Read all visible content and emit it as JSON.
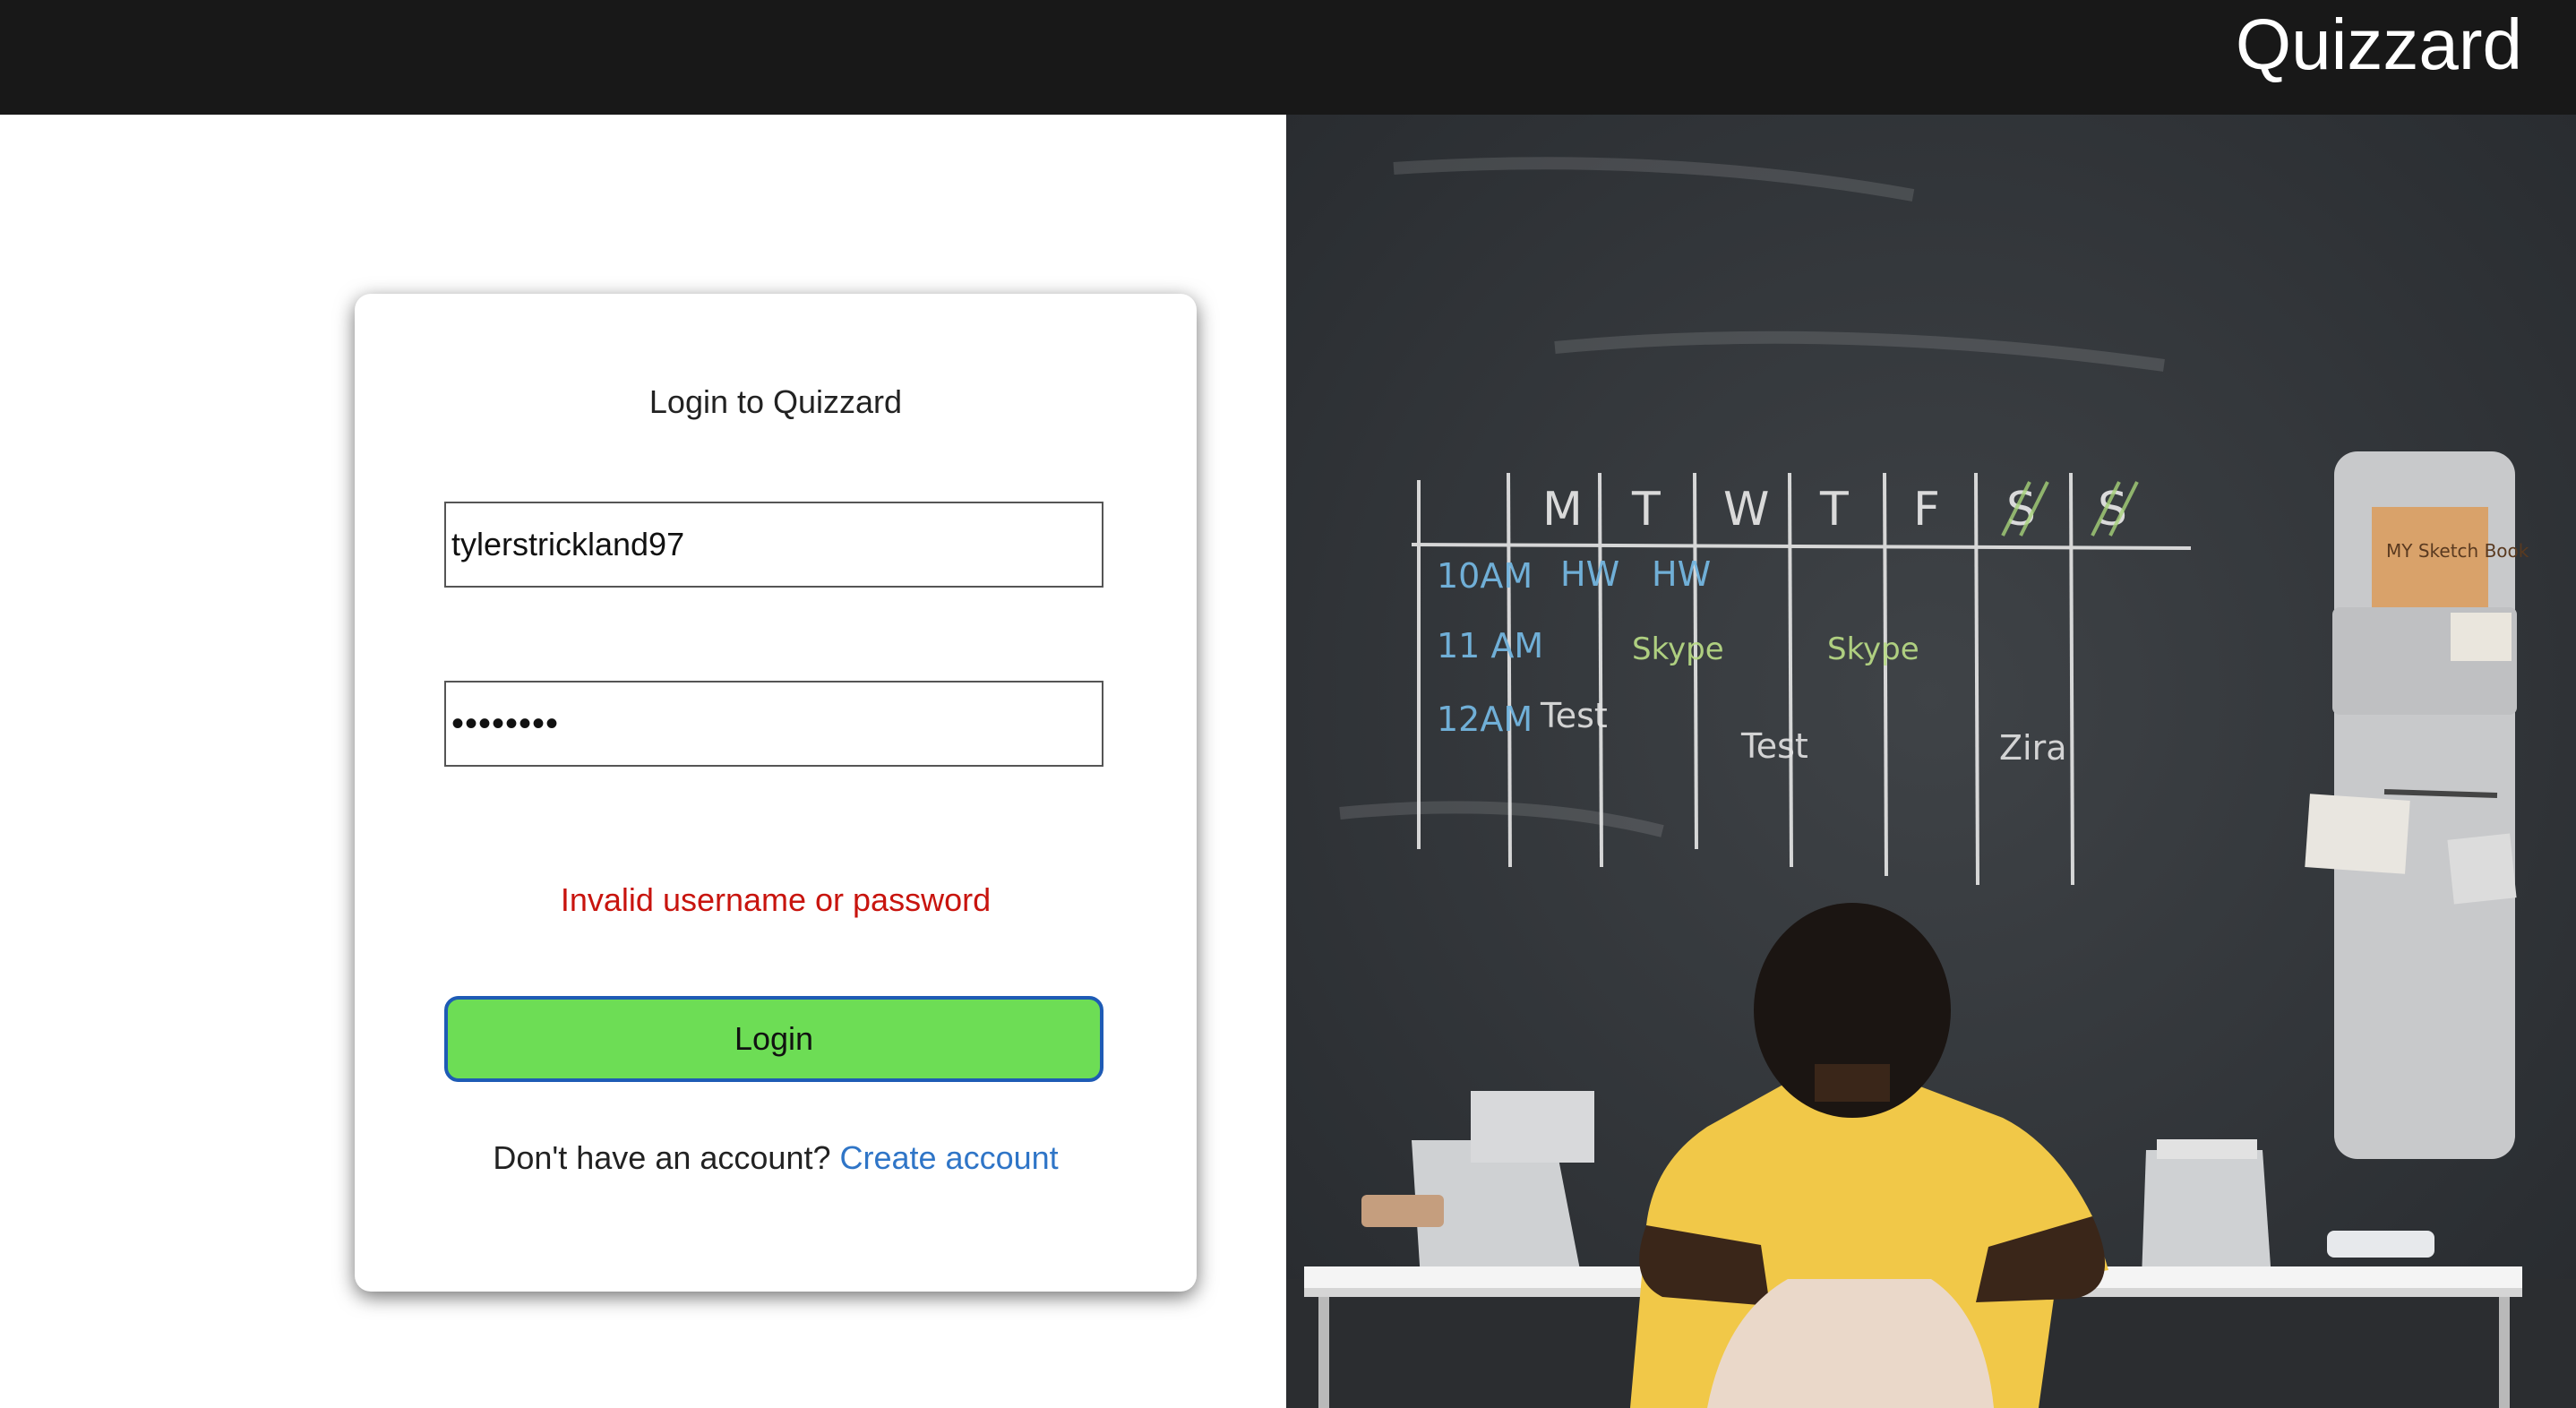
{
  "header": {
    "brand": "Quizzard"
  },
  "login_card": {
    "title": "Login to Quizzard",
    "username_value": "tylerstrickland97",
    "password_value": "••••••••",
    "error_message": "Invalid username or password",
    "login_button_label": "Login",
    "signup_prompt": "Don't have an account?",
    "signup_link_label": "Create account"
  },
  "hero_image": {
    "chalk_schedule": {
      "days": [
        "M",
        "T",
        "W",
        "T",
        "F",
        "S",
        "S"
      ],
      "times": [
        "10AM",
        "11 AM",
        "12AM"
      ],
      "entries": [
        "HW",
        "HW",
        "Skype",
        "Skype",
        "Test",
        "Test",
        "Zira"
      ]
    },
    "note_text": "MY Sketch Book"
  },
  "colors": {
    "topbar": "#181818",
    "error": "#c8140e",
    "login_button": "#6ddd55",
    "login_button_border": "#1e5bb5",
    "link": "#2f75c7"
  }
}
